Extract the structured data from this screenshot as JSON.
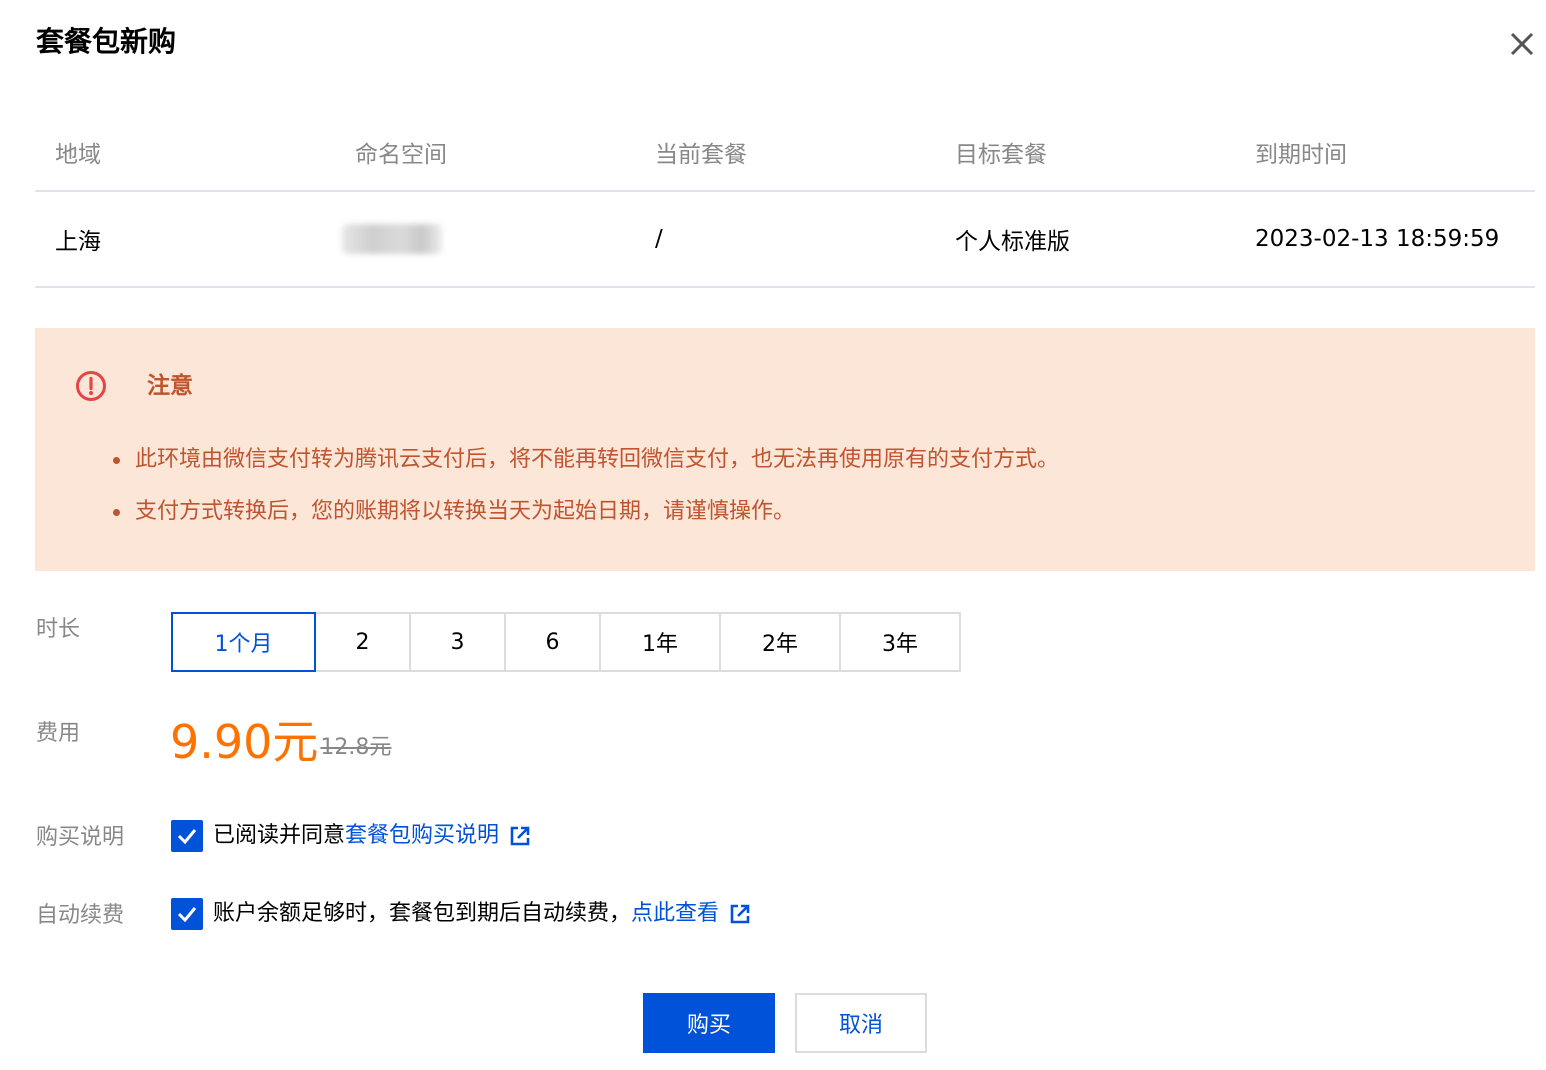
{
  "dialog": {
    "title": "套餐包新购"
  },
  "table": {
    "headers": [
      "地域",
      "命名空间",
      "当前套餐",
      "目标套餐",
      "到期时间"
    ],
    "row": {
      "region": "上海",
      "current_plan": "/",
      "target_plan": "个人标准版",
      "expire_time": "2023-02-13 18:59:59"
    }
  },
  "notice": {
    "title": "注意",
    "items": [
      "此环境由微信支付转为腾讯云支付后，将不能再转回微信支付，也无法再使用原有的支付方式。",
      "支付方式转换后，您的账期将以转换当天为起始日期，请谨慎操作。"
    ],
    "color": "#c0542f",
    "background": "#fbe6d8"
  },
  "form": {
    "duration_label": "时长",
    "duration_options": [
      "1个月",
      "2",
      "3",
      "6",
      "1年",
      "2年",
      "3年"
    ],
    "duration_selected": "1个月",
    "cost_label": "费用",
    "price_current": "9.90元",
    "price_original": "12.8元",
    "desc_label": "购买说明",
    "desc_text": "已阅读并同意",
    "desc_link": "套餐包购买说明",
    "desc_checked": true,
    "renew_label": "自动续费",
    "renew_text": "账户余额足够时，套餐包到期后自动续费，",
    "renew_link": "点此查看",
    "renew_checked": true
  },
  "buttons": {
    "buy": "购买",
    "cancel": "取消"
  },
  "colors": {
    "primary": "#0052d9",
    "price": "#ff7200",
    "muted": "#888888"
  },
  "icons": {
    "close": "close-icon",
    "warning": "exclamation-circle-icon",
    "checkbox": "check-icon",
    "external_link": "external-link-icon"
  }
}
